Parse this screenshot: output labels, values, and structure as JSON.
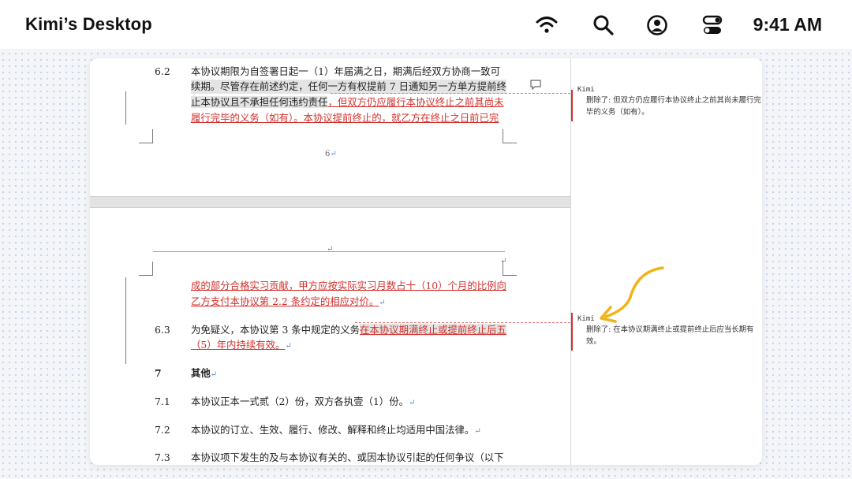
{
  "menubar": {
    "title": "Kimi’s Desktop",
    "time": "9:41 AM",
    "icons": [
      "wifi-icon",
      "search-icon",
      "user-account-icon",
      "control-center-icon"
    ]
  },
  "document": {
    "page1": {
      "clause_6_2": {
        "number": "6.2",
        "line1": "本协议期限为自签署日起一（1）年届满之日，期满后经双方协商一致可",
        "line2": "续期。尽管存在前述约定，任何一方有权提前 7 日通知另一方单方提前终",
        "line3_plain": "止本协议且不承担任何违约责任",
        "line3_ins": "，但双方仍应履行本协议终止之前其尚未",
        "line4_ins": "履行完毕的义务（如有）。本协议提前终止的，就乙方在终止之日前已完"
      },
      "page_number": "6",
      "page_mark": "↵"
    },
    "page2": {
      "header_mark": "↵",
      "header_mark2": "↵",
      "continued_line1": "成的部分合格实习贡献，甲方应按实际实习月数占十（10）个月的比例向",
      "continued_line2": "乙方支付本协议第 2.2 条约定的相应对价。",
      "clause_6_3": {
        "number": "6.3",
        "line1_plain": "为免疑义，本协议第 3 条中规定的义务",
        "line1_ins": "在本协议期满终止或提前终止后五",
        "line2_ins": "（5）年内持续有效。"
      },
      "section_7": {
        "number": "7",
        "title": "其他"
      },
      "clause_7_1": {
        "number": "7.1",
        "text": "本协议正本一式贰（2）份，双方各执壹（1）份。"
      },
      "clause_7_2": {
        "number": "7.2",
        "text": "本协议的订立、生效、履行、修改、解释和终止均适用中国法律。"
      },
      "clause_7_3": {
        "number": "7.3",
        "text": "本协议项下发生的及与本协议有关的、或因本协议引起的任何争议（以下"
      },
      "paragraph_mark": "↵"
    }
  },
  "comments": [
    {
      "author": "Kimi",
      "label": "删除了:",
      "text": "但双方仍应履行本协议终止之前其尚未履行完毕的义务（如有）。",
      "line1": "删除了: 但双方仍应履行本协议终止之前其尚未履行完",
      "line2": "毕的义务（如有）。"
    },
    {
      "author": "Kimi",
      "label": "删除了:",
      "text": "在本协议期满终止或提前终止后应当长期有效。",
      "line1": "删除了: 在本协议期满终止或提前终止后应当长期有",
      "line2": "效。"
    }
  ],
  "colors": {
    "insertion": "#d0322e",
    "annotation_arrow": "#f0b418",
    "dot_grid": "#c7d1ea"
  }
}
